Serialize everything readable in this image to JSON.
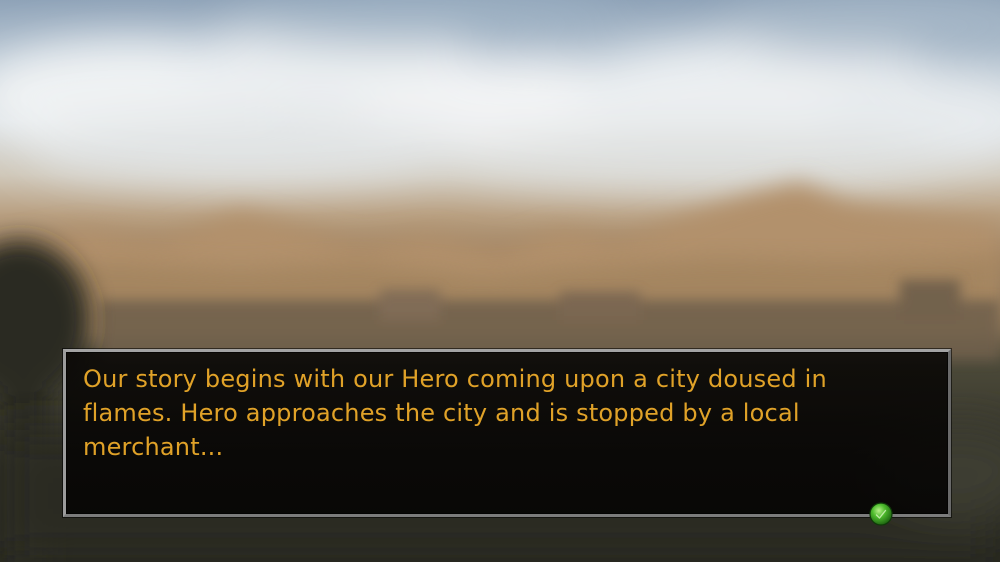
{
  "dialog": {
    "text": "Our story begins with our Hero coming upon a city doused in flames. Hero approaches the city and is stopped by a local merchant...",
    "text_color": "#e0a228"
  },
  "continue_indicator": {
    "icon": "green-orb-icon",
    "color": "#3fae2a"
  }
}
